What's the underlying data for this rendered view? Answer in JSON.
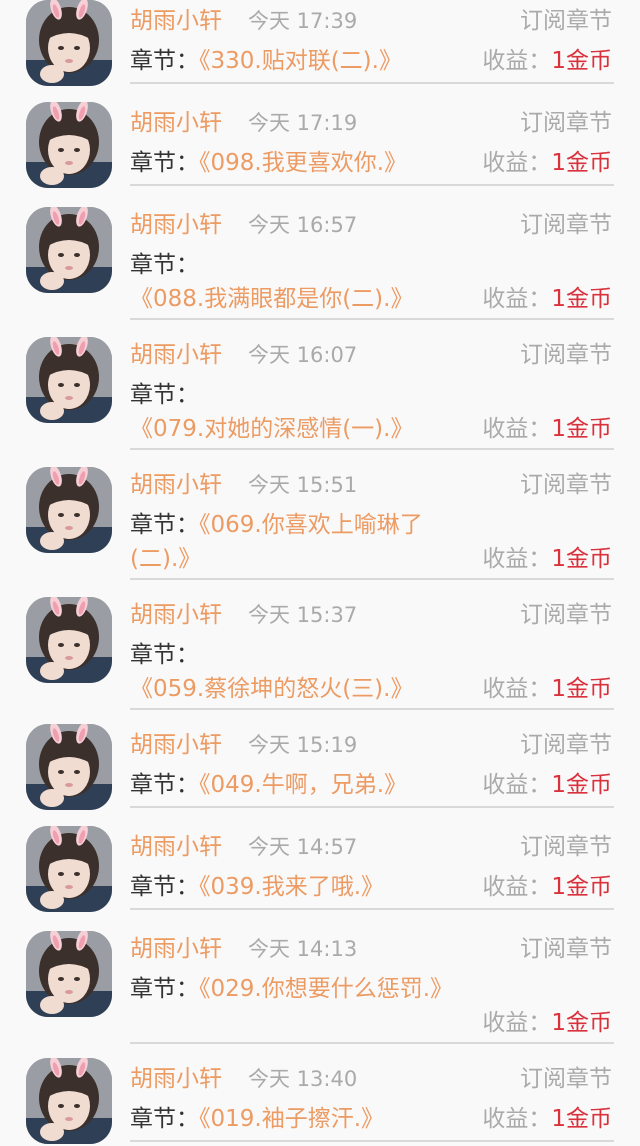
{
  "chapter_label": "章节：",
  "income_label": "收益：",
  "records": [
    {
      "author": "胡雨小轩",
      "time": "今天 17:39",
      "type": "订阅章节",
      "title": "《330.贴对联(二).》",
      "income": "1金币"
    },
    {
      "author": "胡雨小轩",
      "time": "今天 17:19",
      "type": "订阅章节",
      "title": "《098.我更喜欢你.》",
      "income": "1金币"
    },
    {
      "author": "胡雨小轩",
      "time": "今天 16:57",
      "type": "订阅章节",
      "title": "《088.我满眼都是你(二).》",
      "income": "1金币"
    },
    {
      "author": "胡雨小轩",
      "time": "今天 16:07",
      "type": "订阅章节",
      "title": "《079.对她的深感情(一).》",
      "income": "1金币"
    },
    {
      "author": "胡雨小轩",
      "time": "今天 15:51",
      "type": "订阅章节",
      "title": "《069.你喜欢上喻琳了(二).》",
      "income": "1金币"
    },
    {
      "author": "胡雨小轩",
      "time": "今天 15:37",
      "type": "订阅章节",
      "title": "《059.蔡徐坤的怒火(三).》",
      "income": "1金币"
    },
    {
      "author": "胡雨小轩",
      "time": "今天 15:19",
      "type": "订阅章节",
      "title": "《049.牛啊，兄弟.》",
      "income": "1金币"
    },
    {
      "author": "胡雨小轩",
      "time": "今天 14:57",
      "type": "订阅章节",
      "title": "《039.我来了哦.》",
      "income": "1金币"
    },
    {
      "author": "胡雨小轩",
      "time": "今天 14:13",
      "type": "订阅章节",
      "title": "《029.你想要什么惩罚.》",
      "income": "1金币"
    },
    {
      "author": "胡雨小轩",
      "time": "今天 13:40",
      "type": "订阅章节",
      "title": "《019.袖子擦汗.》",
      "income": "1金币"
    }
  ]
}
